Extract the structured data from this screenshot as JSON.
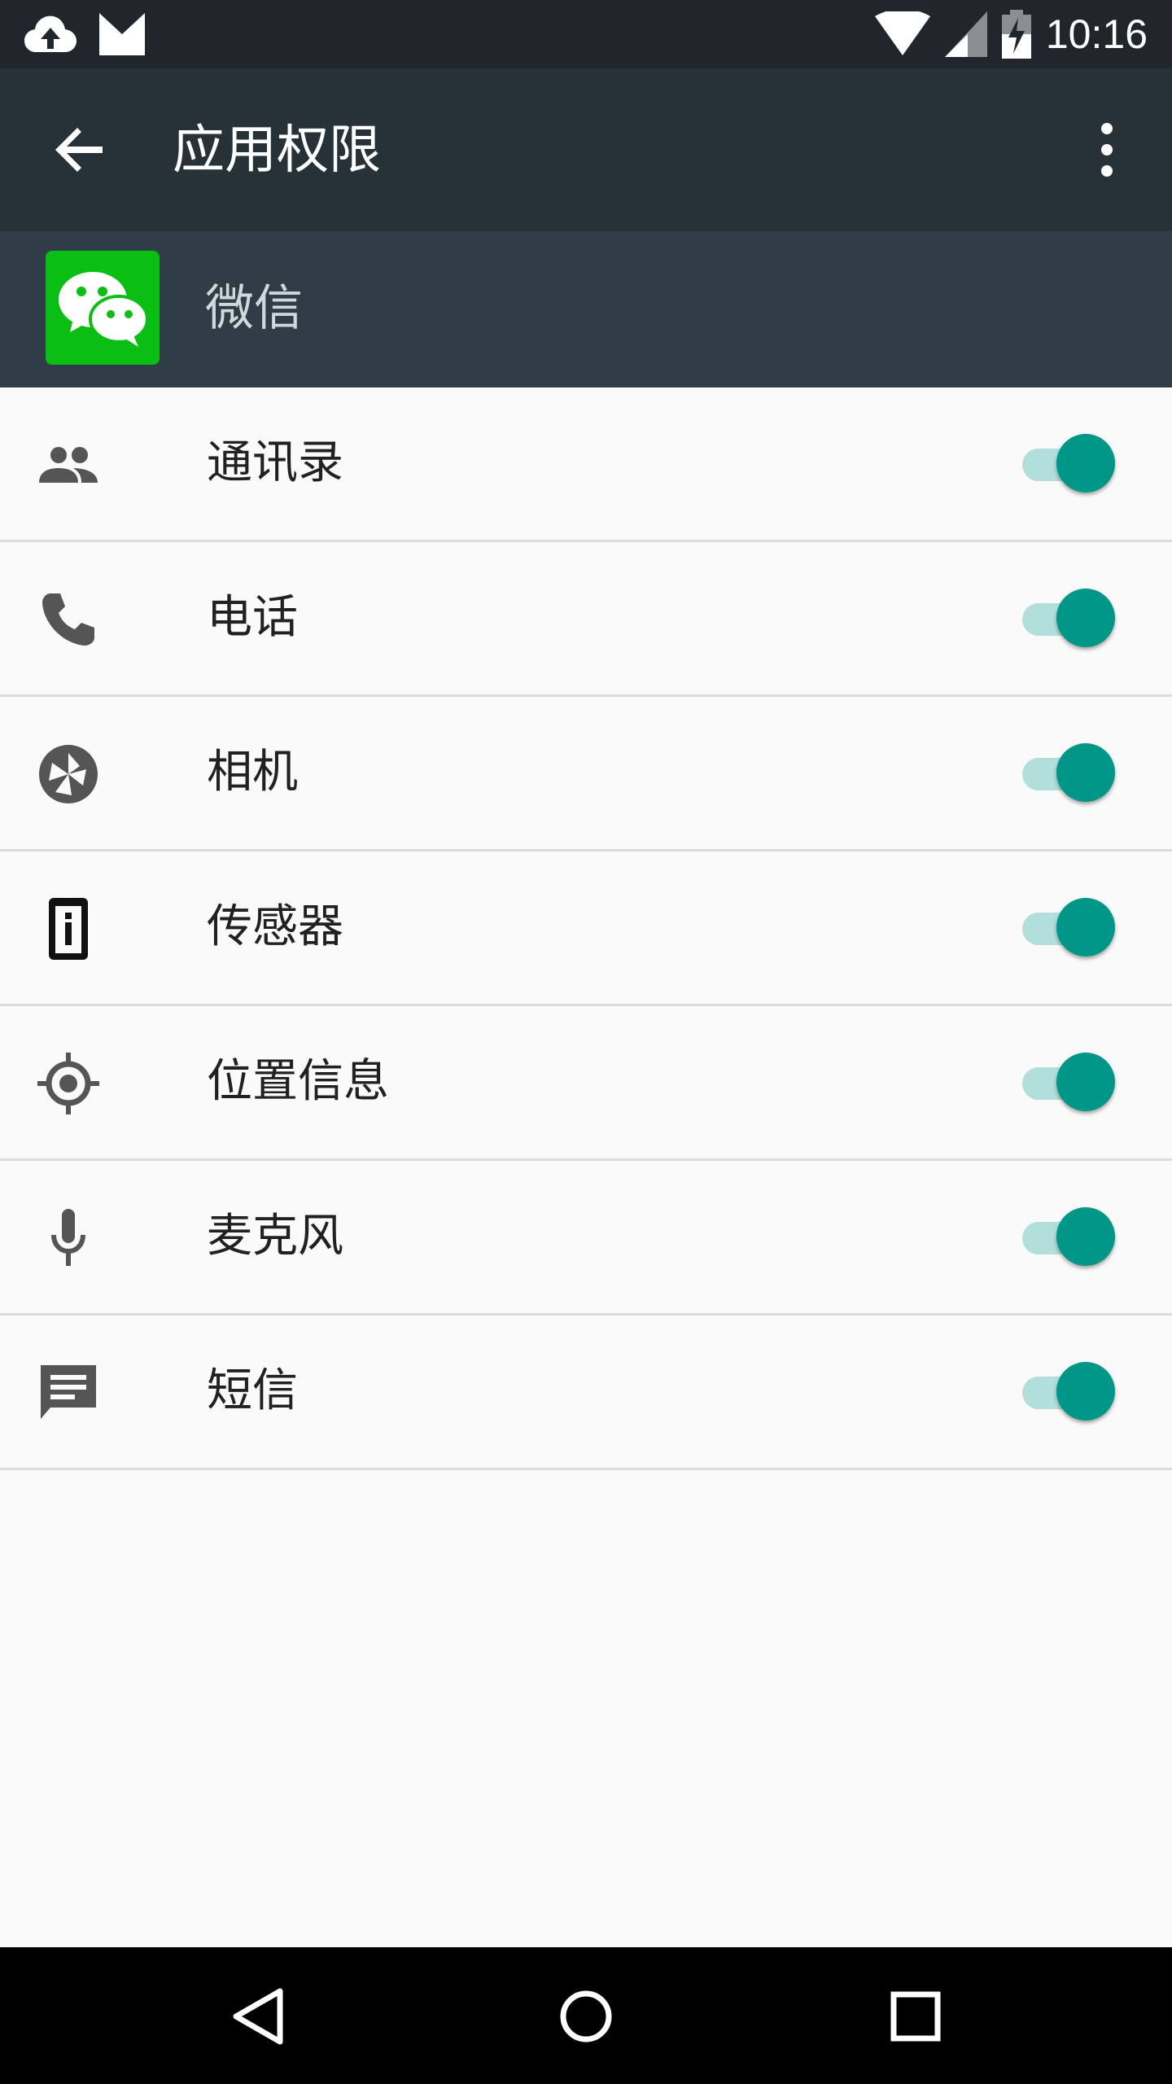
{
  "status_bar": {
    "time": "10:16",
    "icons": [
      "cloud-upload-icon",
      "gmail-icon",
      "wifi-icon",
      "cellular-signal-icon",
      "battery-charging-icon"
    ]
  },
  "app_bar": {
    "title": "应用权限",
    "back_icon": "arrow-back-icon",
    "menu_icon": "more-vert-icon"
  },
  "app": {
    "name": "微信",
    "logo_icon": "wechat-logo"
  },
  "permissions": [
    {
      "label": "通讯录",
      "icon": "contacts-icon",
      "enabled": true
    },
    {
      "label": "电话",
      "icon": "phone-icon",
      "enabled": true
    },
    {
      "label": "相机",
      "icon": "camera-icon",
      "enabled": true
    },
    {
      "label": "传感器",
      "icon": "sensor-icon",
      "enabled": true
    },
    {
      "label": "位置信息",
      "icon": "location-icon",
      "enabled": true
    },
    {
      "label": "麦克风",
      "icon": "microphone-icon",
      "enabled": true
    },
    {
      "label": "短信",
      "icon": "sms-icon",
      "enabled": true
    }
  ],
  "colors": {
    "status_bar": "#20262b",
    "app_bar": "#263238",
    "app_header": "#2f3e46",
    "accent": "#009688",
    "track": "#b2dfdb",
    "wechat_green": "#0bbe14"
  },
  "nav_bar": {
    "icons": [
      "back-triangle-icon",
      "home-circle-icon",
      "recents-square-icon"
    ]
  }
}
